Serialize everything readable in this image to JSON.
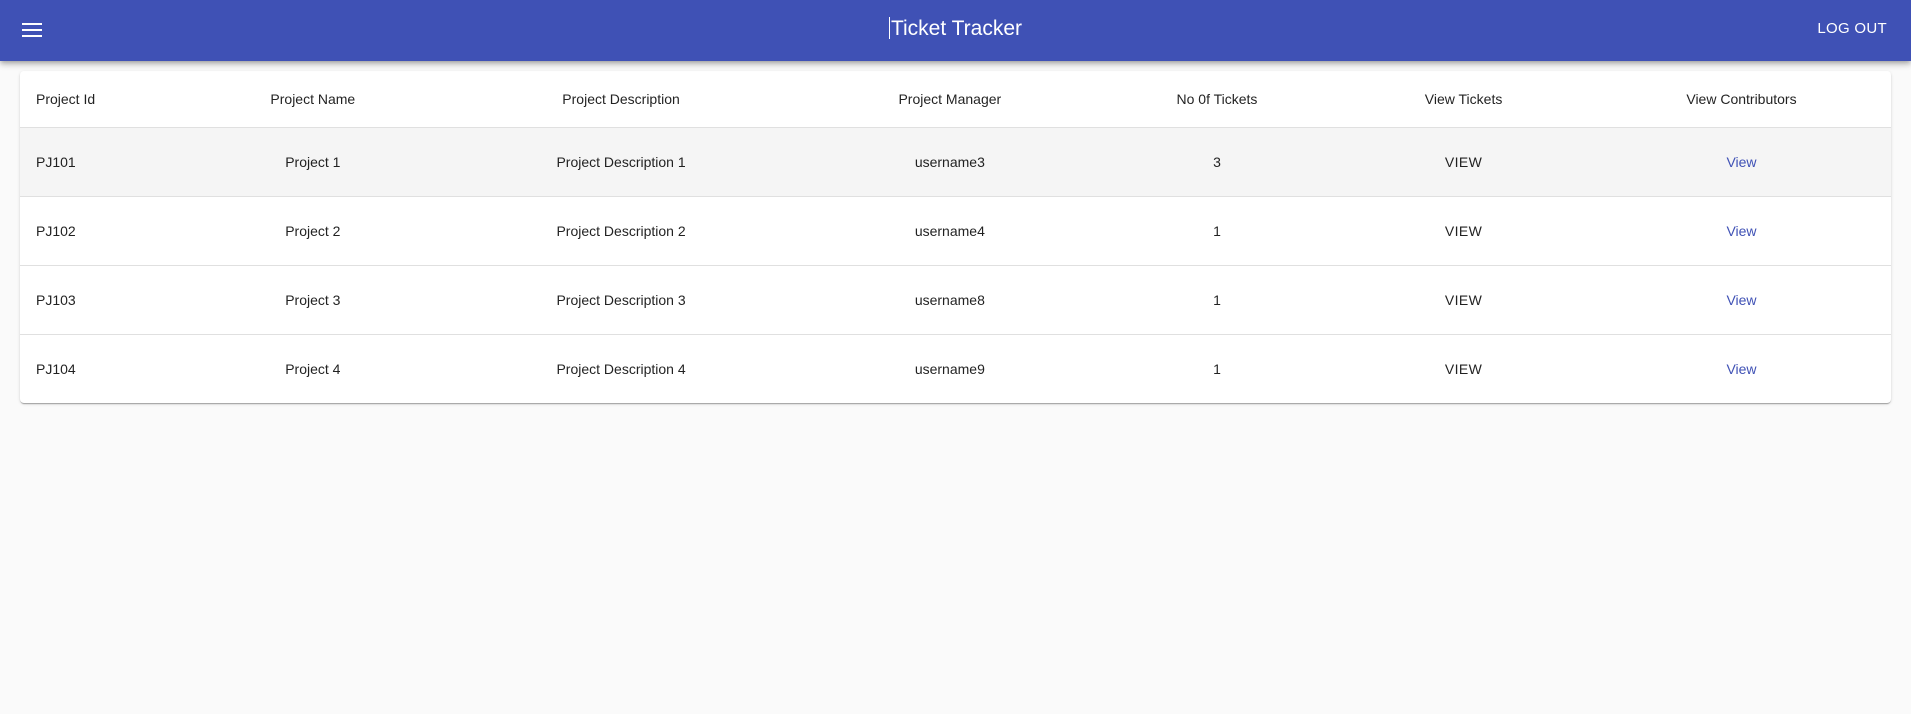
{
  "app": {
    "title": "Ticket Tracker",
    "menu_icon": "menu-icon",
    "logout_label": "LOG OUT"
  },
  "colors": {
    "primary": "#3f51b5",
    "background": "#fafafa",
    "row_hover": "#f5f5f5",
    "link": "#3f51b5"
  },
  "table": {
    "headers": [
      "Project Id",
      "Project Name",
      "Project Description",
      "Project Manager",
      "No 0f Tickets",
      "View Tickets",
      "View Contributors"
    ],
    "rows": [
      {
        "id": "PJ101",
        "name": "Project 1",
        "description": "Project Description 1",
        "manager": "username3",
        "tickets": "3",
        "view_tickets": "VIEW",
        "view_contributors": "View"
      },
      {
        "id": "PJ102",
        "name": "Project 2",
        "description": "Project Description 2",
        "manager": "username4",
        "tickets": "1",
        "view_tickets": "VIEW",
        "view_contributors": "View"
      },
      {
        "id": "PJ103",
        "name": "Project 3",
        "description": "Project Description 3",
        "manager": "username8",
        "tickets": "1",
        "view_tickets": "VIEW",
        "view_contributors": "View"
      },
      {
        "id": "PJ104",
        "name": "Project 4",
        "description": "Project Description 4",
        "manager": "username9",
        "tickets": "1",
        "view_tickets": "VIEW",
        "view_contributors": "View"
      }
    ]
  }
}
